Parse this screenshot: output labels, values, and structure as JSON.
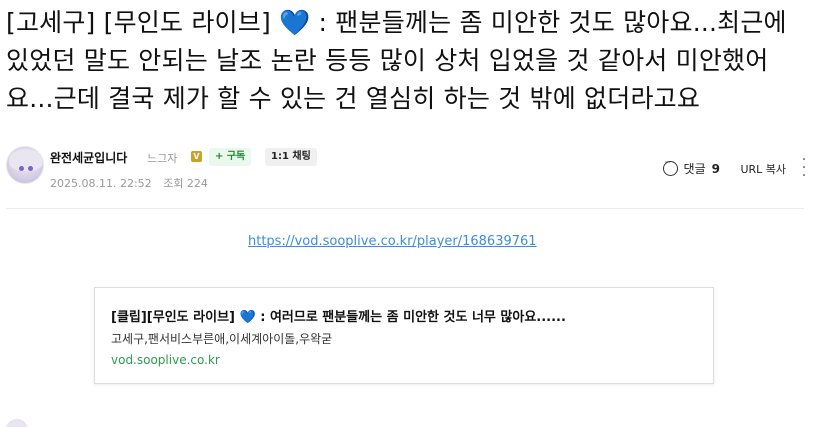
{
  "post": {
    "title_prefix": "[고세구] [무인도 라이브] ",
    "title_heart": "💙",
    "title_rest": " : 팬분들께는 좀 미안한 것도 많아요...최근에 있었던 말도 안되는 날조 논란 등등 많이 상처 입었을 것 같아서 미안했어요...근데 결국 제가 할 수 있는 건 열심히 하는 것 밖에 없더라고요"
  },
  "author": {
    "name": "완전세균입니다",
    "subtitle": "느그자",
    "verified_mark": "V",
    "subscribe_label": "+ 구독",
    "chat_label": "1:1 채팅",
    "date": "2025.08.11. 22:52",
    "views_label": "조회 224"
  },
  "actions": {
    "comments_label": "댓글",
    "comments_count": "9",
    "url_copy_label": "URL 복사",
    "more_icon": "more-vertical-icon"
  },
  "content": {
    "link_url": "https://vod.sooplive.co.kr/player/168639761"
  },
  "link_card": {
    "title_prefix": "[클립][무인도 라이브] ",
    "title_heart": "💙",
    "title_rest": " : 여러므로 팬분들께는 좀 미안한 것도 너무 많아요......",
    "description": "고세구,팬서비스부른애,이세계아이돌,우왁굳",
    "host": "vod.sooplive.co.kr"
  },
  "colors": {
    "link_blue": "#3a8de0",
    "heart_blue": "#3b7be0",
    "subscribe_green": "#1f8a3a",
    "host_green": "#2e9c50"
  }
}
